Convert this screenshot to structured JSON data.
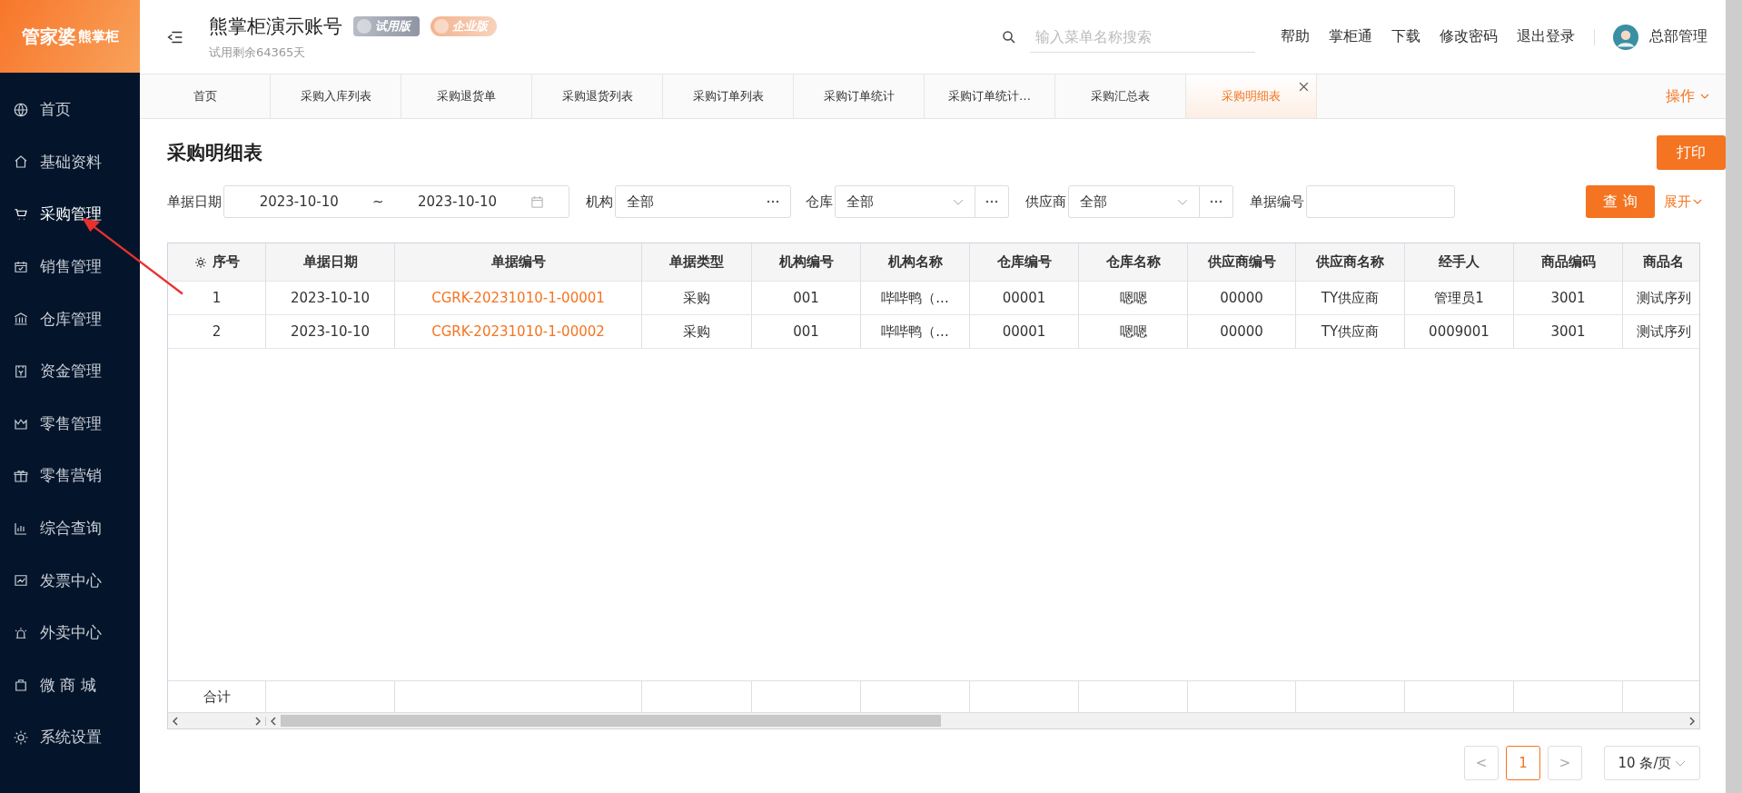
{
  "logo": {
    "brand": "管家婆",
    "product": "熊掌柜"
  },
  "sidebar": {
    "items": [
      {
        "label": "首页",
        "selected": false
      },
      {
        "label": "基础资料",
        "selected": false
      },
      {
        "label": "采购管理",
        "selected": true
      },
      {
        "label": "销售管理",
        "selected": false
      },
      {
        "label": "仓库管理",
        "selected": false
      },
      {
        "label": "资金管理",
        "selected": false
      },
      {
        "label": "零售管理",
        "selected": false
      },
      {
        "label": "零售营销",
        "selected": false
      },
      {
        "label": "综合查询",
        "selected": false
      },
      {
        "label": "发票中心",
        "selected": false
      },
      {
        "label": "外卖中心",
        "selected": false
      },
      {
        "label": "微 商 城",
        "selected": false
      },
      {
        "label": "系统设置",
        "selected": false
      }
    ]
  },
  "header": {
    "account": "熊掌柜演示账号",
    "badges": [
      {
        "kind": "trial",
        "label": "试用版"
      },
      {
        "kind": "enterprise",
        "label": "企业版"
      }
    ],
    "trial_note": "试用剩余64365天",
    "search": {
      "placeholder": "输入菜单名称搜索"
    },
    "links": [
      "帮助",
      "掌柜通",
      "下载",
      "修改密码",
      "退出登录"
    ],
    "user": "总部管理"
  },
  "tabs": [
    {
      "label": "首页",
      "selected": false
    },
    {
      "label": "采购入库列表",
      "selected": false
    },
    {
      "label": "采购退货单",
      "selected": false
    },
    {
      "label": "采购退货列表",
      "selected": false
    },
    {
      "label": "采购订单列表",
      "selected": false
    },
    {
      "label": "采购订单统计",
      "selected": false
    },
    {
      "label": "采购订单统计…",
      "selected": false
    },
    {
      "label": "采购汇总表",
      "selected": false
    },
    {
      "label": "采购明细表",
      "selected": true
    }
  ],
  "operations": "操作",
  "page": {
    "title": "采购明细表",
    "print_button": "打印"
  },
  "filters": {
    "date_label": "单据日期",
    "date_from": "2023-10-10",
    "date_sep": "~",
    "date_to": "2023-10-10",
    "org_label": "机构",
    "org_value": "全部",
    "warehouse_label": "仓库",
    "warehouse_value": "全部",
    "supplier_label": "供应商",
    "supplier_value": "全部",
    "doc_no_label": "单据编号",
    "query_button": "查 询",
    "expand": "展开"
  },
  "table": {
    "columns": [
      "序号",
      "单据日期",
      "单据编号",
      "单据类型",
      "机构编号",
      "机构名称",
      "仓库编号",
      "仓库名称",
      "供应商编号",
      "供应商名称",
      "经手人",
      "商品编码",
      "商品名"
    ],
    "rows": [
      [
        "1",
        "2023-10-10",
        "CGRK-20231010-1-00001",
        "采购",
        "001",
        "哔哔鸭（...",
        "00001",
        "嗯嗯",
        "00000",
        "TY供应商",
        "管理员1",
        "3001",
        "测试序列"
      ],
      [
        "2",
        "2023-10-10",
        "CGRK-20231010-1-00002",
        "采购",
        "001",
        "哔哔鸭（...",
        "00001",
        "嗯嗯",
        "00000",
        "TY供应商",
        "0009001",
        "3001",
        "测试序列"
      ]
    ],
    "total_label": "合计"
  },
  "pagination": {
    "prev": "<",
    "current": "1",
    "next": ">",
    "page_size": "10 条/页"
  }
}
